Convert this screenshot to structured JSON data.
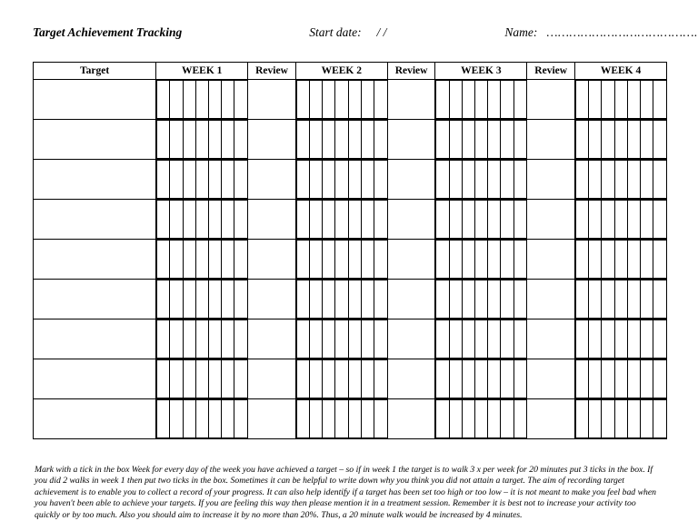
{
  "header": {
    "title": "Target Achievement Tracking",
    "start_date_label": "Start date:",
    "start_date_value": "/    /",
    "name_label": "Name:",
    "name_dots": "……………………………………………"
  },
  "columns": {
    "target": "Target",
    "week1": "WEEK 1",
    "review1": "Review",
    "week2": "WEEK 2",
    "review2": "Review",
    "week3": "WEEK 3",
    "review3": "Review",
    "week4": "WEEK 4"
  },
  "rows": 9,
  "days_per_week": 7,
  "footer": "Mark with a tick in the box Week for every day of the week you have achieved a target – so if in week 1 the target is to walk 3 x per week for 20 minutes put 3 ticks in the box. If you did 2 walks in week 1 then put two ticks in the box. Sometimes it can be helpful to write down why you think you did not attain a target. The aim of recording target achievement is to enable you to collect a record of your progress. It can also help identify if a target has been set too high or too low – it is not meant to make you feel bad when you haven't been able to achieve your targets. If you are feeling this way then please mention it in a treatment session. Remember it is best not to increase your activity too quickly or by too much. Also you should aim to increase it by no more than 20%. Thus, a 20 minute walk would be increased by 4 minutes."
}
